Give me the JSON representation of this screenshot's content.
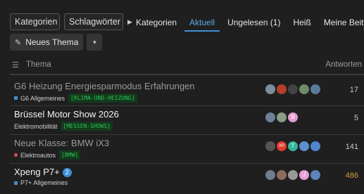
{
  "filters": {
    "categories_label": "Kategorien",
    "tags_label": "Schlagwörter",
    "caret": "▶"
  },
  "nav": {
    "items": [
      "Kategorien",
      "Aktuell",
      "Ungelesen (1)",
      "Heiß",
      "Meine Beiträge"
    ],
    "active": "Aktuell"
  },
  "actions": {
    "new_topic_label": "Neues Thema",
    "more": "▾"
  },
  "table": {
    "col_topic": "Thema",
    "col_replies": "Antworten"
  },
  "topics": [
    {
      "title": "G6 Heizung Energiesparmodus Erfahrungen",
      "read": true,
      "category": "G6 Allgemeines",
      "category_color": "#3d8fd6",
      "tags": [
        "[KLIMA-UND-HEIZUNG]"
      ],
      "replies": "17",
      "avatar_colors": [
        "#7c8e9c",
        "#b34028",
        "#444444",
        "#6f8c6a",
        "#5b7a9a"
      ],
      "avatar_letters": [
        "",
        "",
        "",
        "",
        ""
      ]
    },
    {
      "title": "Brüssel Motor Show 2026",
      "read": false,
      "category": "Elektromobilität",
      "category_color": "",
      "tags": [
        "[MESSEN-SHOWS]"
      ],
      "replies": "5",
      "avatar_colors": [
        "#6d8097",
        "#8b9c85",
        "#e59ad0"
      ],
      "avatar_letters": [
        "",
        "",
        "B"
      ]
    },
    {
      "title": "Neue Klasse: BMW iX3",
      "read": true,
      "category": "Elektroautos",
      "category_color": "#c94b4b",
      "tags": [
        "[BMW]"
      ],
      "replies": "141",
      "avatar_colors": [
        "#555555",
        "#e33a2d",
        "#35b59a",
        "#5c8fcf",
        "#4f86c9"
      ],
      "avatar_letters": [
        "",
        "XP",
        "T",
        "",
        ""
      ]
    },
    {
      "title": "Xpeng P7+",
      "read": false,
      "badge": "2",
      "category": "P7+ Allgemeines",
      "category_color": "#3d8fd6",
      "tags": [],
      "replies": "486",
      "replies_hot": true,
      "avatar_colors": [
        "#6e7e8c",
        "#8a6d5a",
        "#999999",
        "#e7a1d6",
        "#5a86b8"
      ],
      "avatar_letters": [
        "",
        "",
        "",
        "J",
        ""
      ]
    }
  ]
}
